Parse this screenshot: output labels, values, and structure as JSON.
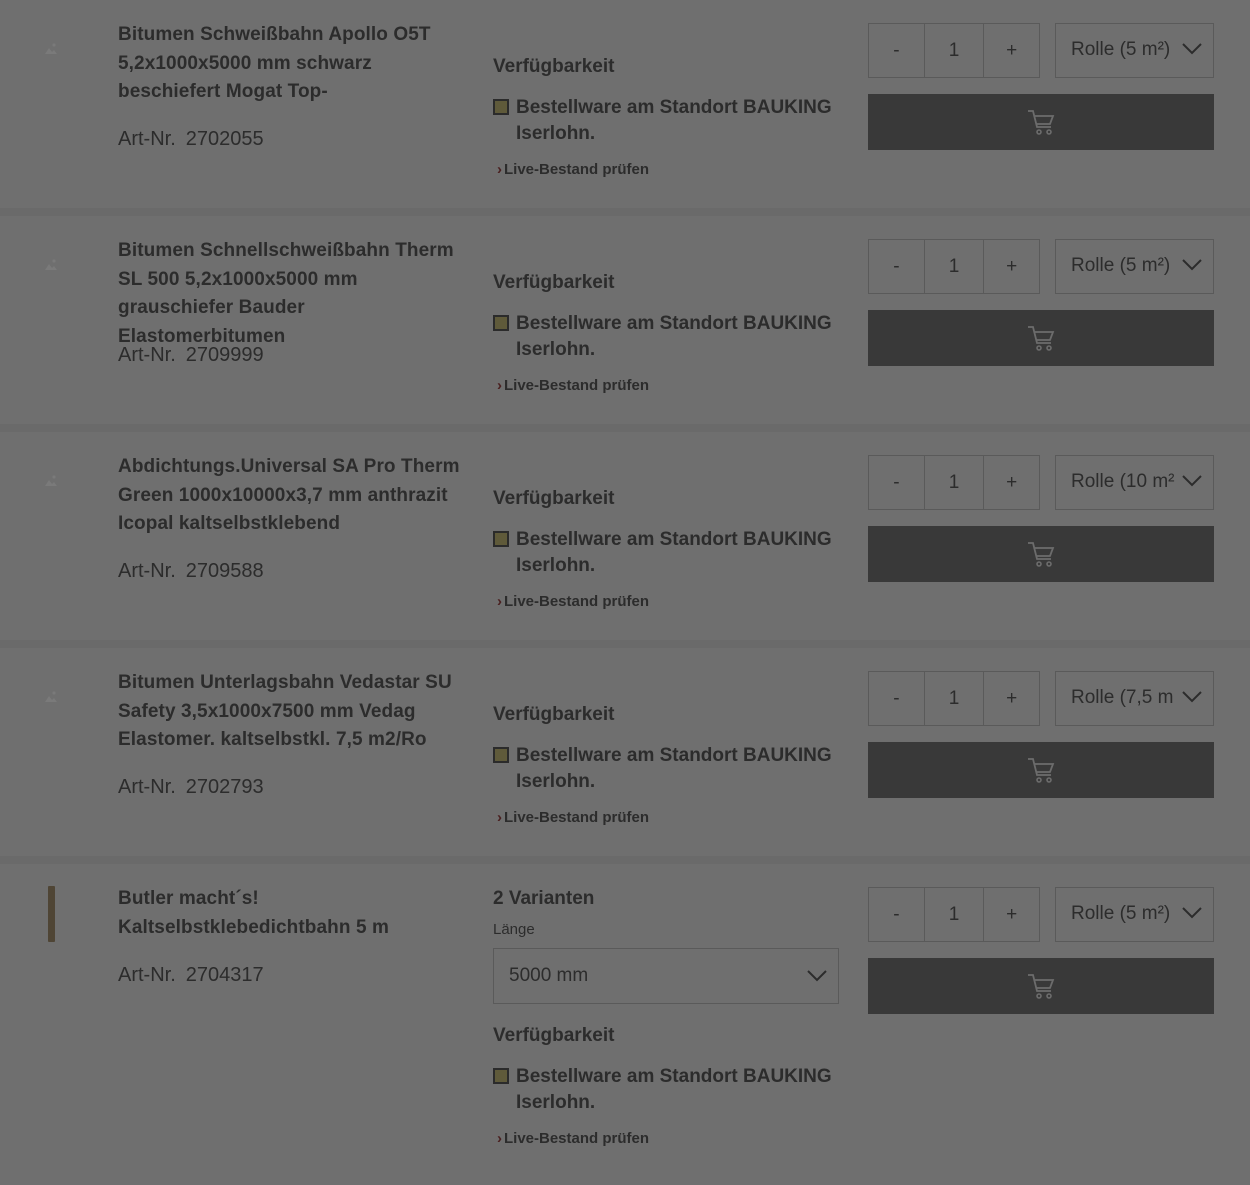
{
  "labels": {
    "availability": "Verfügbarkeit",
    "live_stock": "Live-Bestand prüfen",
    "art_prefix": "Art-Nr.",
    "minus": "-",
    "plus": "+"
  },
  "products": [
    {
      "title": "Bitumen Schweißbahn Apollo O5T 5,2x1000x5000 mm schwarz beschiefert Mogat Top-",
      "art_nr": "2702055",
      "stock": "Bestellware am Standort BAUKING Iserlohn.",
      "qty": "1",
      "unit": "Rolle (5 m²)"
    },
    {
      "title": "Bitumen Schnellschweißbahn Therm SL 500 5,2x1000x5000 mm grauschiefer Bauder Elastomerbitumen",
      "art_nr": "2709999",
      "stock": "Bestellware am Standort BAUKING Iserlohn.",
      "qty": "1",
      "unit": "Rolle (5 m²)"
    },
    {
      "title": "Abdichtungs.Universal SA Pro Therm Green 1000x10000x3,7 mm anthrazit Icopal kaltselbstklebend",
      "art_nr": "2709588",
      "stock": "Bestellware am Standort BAUKING Iserlohn.",
      "qty": "1",
      "unit": "Rolle (10 m²"
    },
    {
      "title": "Bitumen Unterlagsbahn Vedastar SU Safety 3,5x1000x7500 mm Vedag Elastomer. kaltselbstkl. 7,5 m2/Ro",
      "art_nr": "2702793",
      "stock": "Bestellware am Standort BAUKING Iserlohn.",
      "qty": "1",
      "unit": "Rolle (7,5 m"
    },
    {
      "title": "Butler macht´s! Kaltselbstklebedichtbahn 5 m",
      "art_nr": "2704317",
      "variants": "2 Varianten",
      "variant_label": "Länge",
      "variant_value": "5000 mm",
      "stock": "Bestellware am Standort BAUKING Iserlohn.",
      "qty": "1",
      "unit": "Rolle (5 m²)"
    }
  ],
  "icons": {
    "cart": "cart-icon",
    "chevron": "chevron-down-icon",
    "placeholder": "image-placeholder-icon"
  },
  "colors": {
    "overlay_bg": "#707070",
    "button_bg": "#393939",
    "stock_indicator": "#5f5a3a",
    "live_arrow": "#4a2020"
  }
}
